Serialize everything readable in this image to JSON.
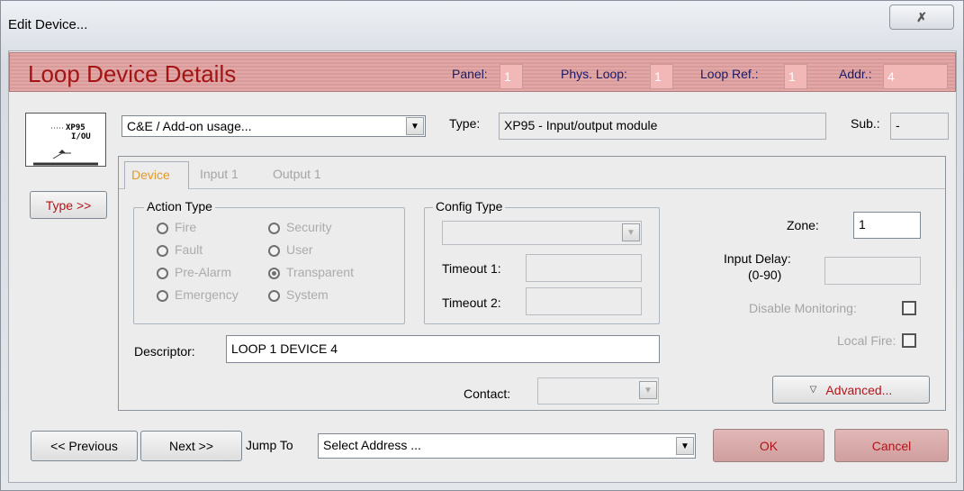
{
  "window": {
    "title": "Edit Device...",
    "close_glyph": "✗"
  },
  "header": {
    "title": "Loop Device Details",
    "panel_label": "Panel:",
    "panel_value": "1",
    "phys_loop_label": "Phys. Loop:",
    "phys_loop_value": "1",
    "loop_ref_label": "Loop Ref.:",
    "loop_ref_value": "1",
    "addr_label": "Addr.:",
    "addr_value": "4"
  },
  "device": {
    "image_text_1": "XP95",
    "image_text_2": "I/OU",
    "usage_value": "C&E / Add-on usage...",
    "type_label": "Type:",
    "type_value": "XP95 - Input/output module",
    "sub_label": "Sub.:",
    "sub_value": "-",
    "type_button": "Type >>"
  },
  "tabs": [
    "Device",
    "Input 1",
    "Output 1"
  ],
  "action_type": {
    "title": "Action Type",
    "options": [
      "Fire",
      "Security",
      "Fault",
      "User",
      "Pre-Alarm",
      "Transparent",
      "Emergency",
      "System"
    ],
    "selected": "Transparent"
  },
  "config_type": {
    "title": "Config Type",
    "timeout1_label": "Timeout 1:",
    "timeout2_label": "Timeout 2:"
  },
  "right_panel": {
    "zone_label": "Zone:",
    "zone_value": "1",
    "input_delay_label": "Input Delay:",
    "input_delay_range": "(0-90)",
    "disable_monitoring_label": "Disable Monitoring:",
    "local_fire_label": "Local Fire:",
    "advanced_button": "Advanced..."
  },
  "descriptor": {
    "label": "Descriptor:",
    "value": "LOOP 1 DEVICE 4"
  },
  "contact": {
    "label": "Contact:"
  },
  "footer": {
    "previous_button": "<< Previous",
    "next_button": "Next >>",
    "jump_to_label": "Jump To",
    "jump_to_value": "Select Address ...",
    "ok_button": "OK",
    "cancel_button": "Cancel"
  },
  "colors": {
    "header_title": "#a31414",
    "accent_red": "#b3141a",
    "active_tab": "#e29a2a"
  }
}
